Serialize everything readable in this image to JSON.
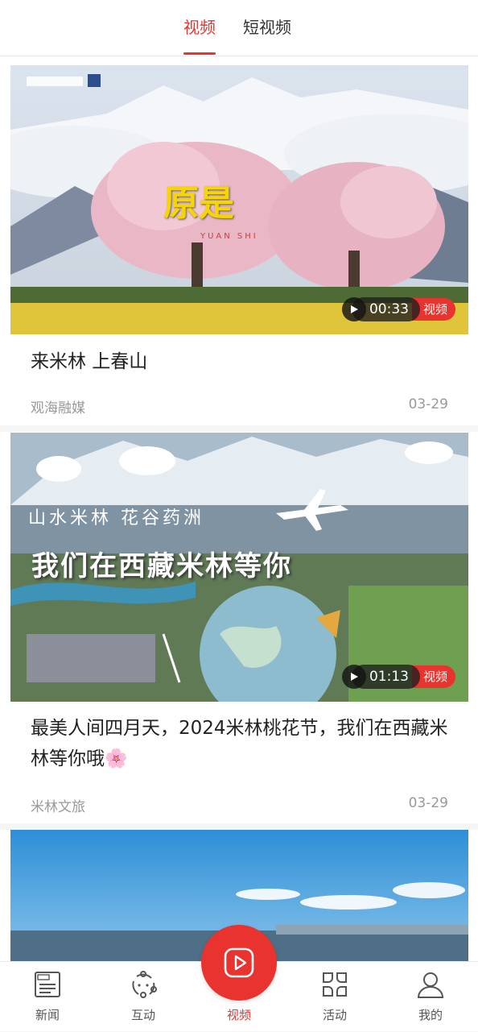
{
  "top_tabs": [
    {
      "label": "视频",
      "active": true
    },
    {
      "label": "短视频",
      "active": false
    }
  ],
  "feed": [
    {
      "title": "来米林 上春山",
      "source": "观海融媒",
      "date": "03-29",
      "duration": "00:33",
      "badge": "视频",
      "overlay_text": "原是",
      "overlay_sub": "YUAN SHI"
    },
    {
      "title": "最美人间四月天，2024米林桃花节，我们在西藏米林等你哦🌸",
      "source": "米林文旅",
      "date": "03-29",
      "duration": "01:13",
      "badge": "视频",
      "overlay_line1": "山水米林 花谷药洲",
      "overlay_line2": "我们在西藏米林等你"
    },
    {
      "title": "",
      "source": "",
      "date": "",
      "duration": "",
      "badge": ""
    }
  ],
  "bottom_nav": [
    {
      "label": "新闻",
      "icon": "newspaper-icon"
    },
    {
      "label": "互动",
      "icon": "interact-icon"
    },
    {
      "label": "视频",
      "icon": "play-icon",
      "active": true
    },
    {
      "label": "活动",
      "icon": "grid-icon"
    },
    {
      "label": "我的",
      "icon": "user-icon"
    }
  ],
  "colors": {
    "accent": "#e8332e",
    "text": "#222222",
    "muted": "#999999"
  }
}
